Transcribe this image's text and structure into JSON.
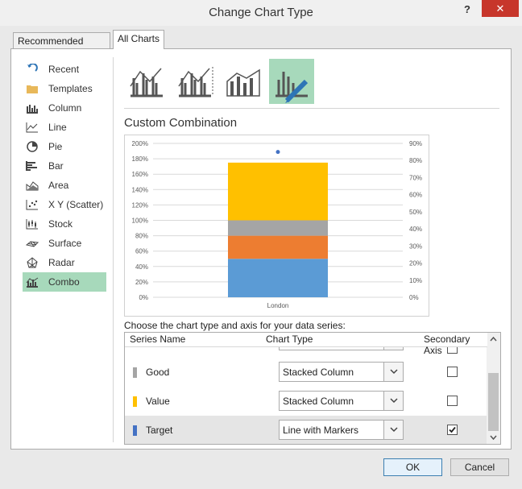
{
  "dialog": {
    "title": "Change Chart Type",
    "help": "?",
    "close": "✕"
  },
  "tabs": [
    {
      "label": "Recommended Charts",
      "active": false
    },
    {
      "label": "All Charts",
      "active": true
    }
  ],
  "sidebar": {
    "items": [
      {
        "label": "Recent",
        "icon": "recent-icon"
      },
      {
        "label": "Templates",
        "icon": "templates-icon"
      },
      {
        "label": "Column",
        "icon": "column-chart-icon"
      },
      {
        "label": "Line",
        "icon": "line-chart-icon"
      },
      {
        "label": "Pie",
        "icon": "pie-chart-icon"
      },
      {
        "label": "Bar",
        "icon": "bar-chart-icon"
      },
      {
        "label": "Area",
        "icon": "area-chart-icon"
      },
      {
        "label": "X Y (Scatter)",
        "icon": "scatter-chart-icon"
      },
      {
        "label": "Stock",
        "icon": "stock-chart-icon"
      },
      {
        "label": "Surface",
        "icon": "surface-chart-icon"
      },
      {
        "label": "Radar",
        "icon": "radar-chart-icon"
      },
      {
        "label": "Combo",
        "icon": "combo-chart-icon",
        "selected": true
      }
    ]
  },
  "subtypes": [
    {
      "icon": "clustered-column-line-icon"
    },
    {
      "icon": "clustered-column-line-secondary-icon"
    },
    {
      "icon": "stacked-area-clustered-column-icon"
    },
    {
      "icon": "custom-combination-icon",
      "selected": true
    }
  ],
  "section_title": "Custom Combination",
  "chart_data": {
    "type": "bar",
    "stacked": true,
    "categories": [
      "London"
    ],
    "series": [
      {
        "name": "",
        "values": [
          50
        ],
        "color": "#5b9bd5",
        "axis": "primary"
      },
      {
        "name": "",
        "values": [
          30
        ],
        "color": "#ed7d31",
        "axis": "primary"
      },
      {
        "name": "Good",
        "values": [
          20
        ],
        "color": "#a5a5a5",
        "axis": "primary"
      },
      {
        "name": "Value",
        "values": [
          75
        ],
        "color": "#ffc000",
        "axis": "primary"
      },
      {
        "name": "Target",
        "values": [
          85
        ],
        "color": "#4472c4",
        "axis": "secondary",
        "marker": "dot"
      }
    ],
    "y_ticks": [
      "0%",
      "20%",
      "40%",
      "60%",
      "80%",
      "100%",
      "120%",
      "140%",
      "160%",
      "180%",
      "200%"
    ],
    "y2_ticks": [
      "0%",
      "10%",
      "20%",
      "30%",
      "40%",
      "50%",
      "60%",
      "70%",
      "80%",
      "90%"
    ],
    "ylim": [
      0,
      200
    ],
    "y2lim": [
      0,
      90
    ],
    "grid": true
  },
  "series_panel": {
    "label": "Choose the chart type and axis for your data series:",
    "headers": {
      "name": "Series Name",
      "type": "Chart Type",
      "axis": "Secondary Axis"
    },
    "rows": [
      {
        "name": "Good",
        "color": "#a5a5a5",
        "type": "Stacked Column",
        "secondary": false
      },
      {
        "name": "Value",
        "color": "#ffc000",
        "type": "Stacked Column",
        "secondary": false
      },
      {
        "name": "Target",
        "color": "#4472c4",
        "type": "Line with Markers",
        "secondary": true
      }
    ]
  },
  "buttons": {
    "ok": "OK",
    "cancel": "Cancel"
  }
}
